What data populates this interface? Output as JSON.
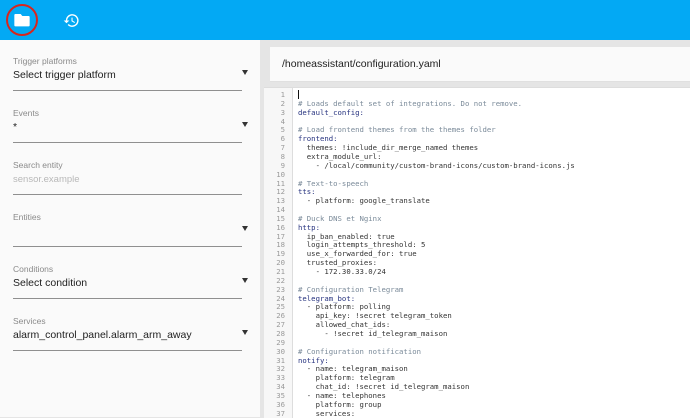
{
  "toolbar": {
    "folder_icon": "folder-icon",
    "history_icon": "history-icon",
    "accent": "#03a9f4",
    "highlight_ring": "#d9251d"
  },
  "sidebar": {
    "trigger": {
      "label": "Trigger platforms",
      "value": "Select trigger platform"
    },
    "events": {
      "label": "Events",
      "value": "*"
    },
    "search": {
      "label": "Search entity",
      "placeholder": "sensor.example"
    },
    "entities": {
      "label": "Entities",
      "value": ""
    },
    "conditions": {
      "label": "Conditions",
      "value": "Select condition"
    },
    "services": {
      "label": "Services",
      "value": "alarm_control_panel.alarm_arm_away"
    }
  },
  "file": {
    "path": "/homeassistant/configuration.yaml"
  },
  "code": [
    {
      "n": "1",
      "t": ""
    },
    {
      "n": "2",
      "t": "# Loads default set of integrations. Do not remove."
    },
    {
      "n": "3",
      "t": "default_config:"
    },
    {
      "n": "4",
      "t": ""
    },
    {
      "n": "5",
      "t": "# Load frontend themes from the themes folder"
    },
    {
      "n": "6",
      "t": "frontend:"
    },
    {
      "n": "7",
      "t": "  themes: !include_dir_merge_named themes"
    },
    {
      "n": "8",
      "t": "  extra_module_url:"
    },
    {
      "n": "9",
      "t": "    - /local/community/custom-brand-icons/custom-brand-icons.js"
    },
    {
      "n": "10",
      "t": ""
    },
    {
      "n": "11",
      "t": "# Text-to-speech"
    },
    {
      "n": "12",
      "t": "tts:"
    },
    {
      "n": "13",
      "t": "  - platform: google_translate"
    },
    {
      "n": "14",
      "t": ""
    },
    {
      "n": "15",
      "t": "# Duck DNS et Nginx"
    },
    {
      "n": "16",
      "t": "http:"
    },
    {
      "n": "17",
      "t": "  ip_ban_enabled: true"
    },
    {
      "n": "18",
      "t": "  login_attempts_threshold: 5"
    },
    {
      "n": "19",
      "t": "  use_x_forwarded_for: true"
    },
    {
      "n": "20",
      "t": "  trusted_proxies:"
    },
    {
      "n": "21",
      "t": "    - 172.30.33.0/24"
    },
    {
      "n": "22",
      "t": ""
    },
    {
      "n": "23",
      "t": "# Configuration Telegram"
    },
    {
      "n": "24",
      "t": "telegram_bot:"
    },
    {
      "n": "25",
      "t": "  - platform: polling"
    },
    {
      "n": "26",
      "t": "    api_key: !secret telegram_token"
    },
    {
      "n": "27",
      "t": "    allowed_chat_ids:"
    },
    {
      "n": "28",
      "t": "      - !secret id_telegram_maison"
    },
    {
      "n": "29",
      "t": ""
    },
    {
      "n": "30",
      "t": "# Configuration notification"
    },
    {
      "n": "31",
      "t": "notify:"
    },
    {
      "n": "32",
      "t": "  - name: telegram_maison"
    },
    {
      "n": "33",
      "t": "    platform: telegram"
    },
    {
      "n": "34",
      "t": "    chat_id: !secret id_telegram_maison"
    },
    {
      "n": "35",
      "t": "  - name: telephones"
    },
    {
      "n": "36",
      "t": "    platform: group"
    },
    {
      "n": "37",
      "t": "    services:"
    }
  ]
}
